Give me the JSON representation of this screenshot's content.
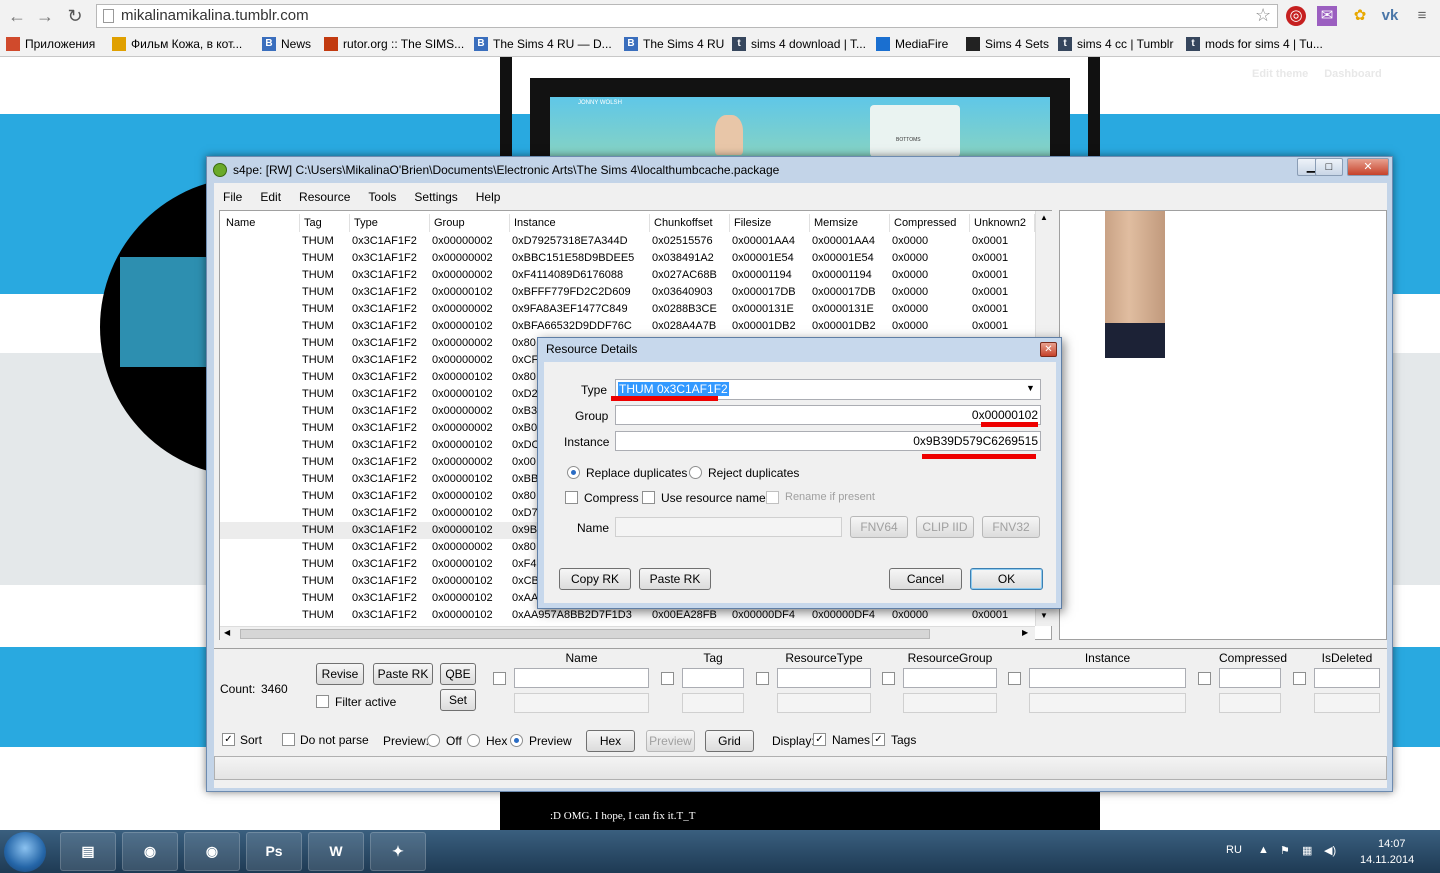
{
  "browser": {
    "url": "mikalinamikalina.tumblr.com",
    "bookmarks": [
      {
        "label": "Приложения",
        "icon": "apps-grid-icon",
        "color": "#d04a2c"
      },
      {
        "label": "Фильм Кожа, в кот...",
        "icon": "film-icon",
        "color": "#e0a000"
      },
      {
        "label": "News",
        "icon": "b-icon",
        "color": "#3a6ebd"
      },
      {
        "label": "rutor.org :: The SIMS...",
        "icon": "rutor-icon",
        "color": "#c23a10"
      },
      {
        "label": "The Sims 4 RU — D...",
        "icon": "b-icon",
        "color": "#3a6ebd"
      },
      {
        "label": "The Sims 4 RU",
        "icon": "b-icon",
        "color": "#3a6ebd"
      },
      {
        "label": "sims 4 download | T...",
        "icon": "tumblr-icon",
        "color": "#36465d"
      },
      {
        "label": "MediaFire",
        "icon": "mediafire-icon",
        "color": "#1a6fd0"
      },
      {
        "label": "Sims 4 Sets",
        "icon": "tsr-icon",
        "color": "#222"
      },
      {
        "label": "sims 4 cc | Tumblr",
        "icon": "tumblr-icon",
        "color": "#36465d"
      },
      {
        "label": "mods for sims 4 | Tu...",
        "icon": "tumblr-icon",
        "color": "#36465d"
      }
    ]
  },
  "blog": {
    "edit_theme": "Edit theme",
    "dashboard": "Dashboard",
    "caption": ":D OMG. I hope, I can fix it.T_T",
    "game_name": "JONNY WOLSH",
    "game_category": "BOTTOMS"
  },
  "s4pe": {
    "title": "s4pe: [RW] C:\\Users\\MikalinaO'Brien\\Documents\\Electronic Arts\\The Sims 4\\localthumbcache.package",
    "menu": [
      "File",
      "Edit",
      "Resource",
      "Tools",
      "Settings",
      "Help"
    ],
    "columns": [
      "Name",
      "Tag",
      "Type",
      "Group",
      "Instance",
      "Chunkoffset",
      "Filesize",
      "Memsize",
      "Compressed",
      "Unknown2"
    ],
    "rows": [
      [
        "",
        "THUM",
        "0x3C1AF1F2",
        "0x00000002",
        "0xD79257318E7A344D",
        "0x02515576",
        "0x00001AA4",
        "0x00001AA4",
        "0x0000",
        "0x0001"
      ],
      [
        "",
        "THUM",
        "0x3C1AF1F2",
        "0x00000002",
        "0xBBC151E58D9BDEE5",
        "0x038491A2",
        "0x00001E54",
        "0x00001E54",
        "0x0000",
        "0x0001"
      ],
      [
        "",
        "THUM",
        "0x3C1AF1F2",
        "0x00000002",
        "0xF4114089D6176088",
        "0x027AC68B",
        "0x00001194",
        "0x00001194",
        "0x0000",
        "0x0001"
      ],
      [
        "",
        "THUM",
        "0x3C1AF1F2",
        "0x00000102",
        "0xBFFF779FD2C2D609",
        "0x03640903",
        "0x000017DB",
        "0x000017DB",
        "0x0000",
        "0x0001"
      ],
      [
        "",
        "THUM",
        "0x3C1AF1F2",
        "0x00000002",
        "0x9FA8A3EF1477C849",
        "0x0288B3CE",
        "0x0000131E",
        "0x0000131E",
        "0x0000",
        "0x0001"
      ],
      [
        "",
        "THUM",
        "0x3C1AF1F2",
        "0x00000102",
        "0xBFA66532D9DDF76C",
        "0x028A4A7B",
        "0x00001DB2",
        "0x00001DB2",
        "0x0000",
        "0x0001"
      ],
      [
        "",
        "THUM",
        "0x3C1AF1F2",
        "0x00000002",
        "0x80",
        "",
        "",
        "",
        "",
        ""
      ],
      [
        "",
        "THUM",
        "0x3C1AF1F2",
        "0x00000002",
        "0xCF",
        "",
        "",
        "",
        "",
        ""
      ],
      [
        "",
        "THUM",
        "0x3C1AF1F2",
        "0x00000102",
        "0x80",
        "",
        "",
        "",
        "",
        ""
      ],
      [
        "",
        "THUM",
        "0x3C1AF1F2",
        "0x00000102",
        "0xD2",
        "",
        "",
        "",
        "",
        ""
      ],
      [
        "",
        "THUM",
        "0x3C1AF1F2",
        "0x00000002",
        "0xB3",
        "",
        "",
        "",
        "",
        ""
      ],
      [
        "",
        "THUM",
        "0x3C1AF1F2",
        "0x00000002",
        "0xB0",
        "",
        "",
        "",
        "",
        ""
      ],
      [
        "",
        "THUM",
        "0x3C1AF1F2",
        "0x00000102",
        "0xDC",
        "",
        "",
        "",
        "",
        ""
      ],
      [
        "",
        "THUM",
        "0x3C1AF1F2",
        "0x00000002",
        "0x00",
        "",
        "",
        "",
        "",
        ""
      ],
      [
        "",
        "THUM",
        "0x3C1AF1F2",
        "0x00000102",
        "0xBB",
        "",
        "",
        "",
        "",
        ""
      ],
      [
        "",
        "THUM",
        "0x3C1AF1F2",
        "0x00000102",
        "0x80",
        "",
        "",
        "",
        "",
        ""
      ],
      [
        "",
        "THUM",
        "0x3C1AF1F2",
        "0x00000102",
        "0xD7",
        "",
        "",
        "",
        "",
        ""
      ],
      [
        "",
        "THUM",
        "0x3C1AF1F2",
        "0x00000102",
        "0x9B",
        "",
        "",
        "",
        "",
        ""
      ],
      [
        "",
        "THUM",
        "0x3C1AF1F2",
        "0x00000002",
        "0x80",
        "",
        "",
        "",
        "",
        ""
      ],
      [
        "",
        "THUM",
        "0x3C1AF1F2",
        "0x00000102",
        "0xF4",
        "",
        "",
        "",
        "",
        ""
      ],
      [
        "",
        "THUM",
        "0x3C1AF1F2",
        "0x00000102",
        "0xCB",
        "",
        "",
        "",
        "",
        ""
      ],
      [
        "",
        "THUM",
        "0x3C1AF1F2",
        "0x00000102",
        "0xAA",
        "",
        "",
        "",
        "",
        ""
      ],
      [
        "",
        "THUM",
        "0x3C1AF1F2",
        "0x00000102",
        "0xAA957A8BB2D7F1D3",
        "0x00EA28FB",
        "0x00000DF4",
        "0x00000DF4",
        "0x0000",
        "0x0001"
      ]
    ],
    "selected_row": 17,
    "count_label": "Count:",
    "count_value": "3460",
    "revise": "Revise",
    "paste_rk": "Paste RK",
    "qbe": "QBE",
    "set": "Set",
    "filter_active": "Filter active",
    "filter_columns": [
      "Name",
      "Tag",
      "ResourceType",
      "ResourceGroup",
      "Instance",
      "Compressed",
      "IsDeleted"
    ],
    "sort": "Sort",
    "do_not_parse": "Do not parse",
    "preview_label": "Preview:",
    "preview_off": "Off",
    "preview_hex": "Hex",
    "preview_preview": "Preview",
    "btn_hex": "Hex",
    "btn_preview": "Preview",
    "btn_grid": "Grid",
    "display_label": "Display:",
    "display_names": "Names",
    "display_tags": "Tags"
  },
  "dialog": {
    "title": "Resource Details",
    "type_label": "Type",
    "type_value": "THUM 0x3C1AF1F2",
    "group_label": "Group",
    "group_value": "0x00000102",
    "instance_label": "Instance",
    "instance_value": "0x9B39D579C6269515",
    "replace_duplicates": "Replace duplicates",
    "reject_duplicates": "Reject duplicates",
    "compress": "Compress",
    "use_resource_name": "Use resource name",
    "rename_if_present": "Rename if present",
    "name_label": "Name",
    "fnv64": "FNV64",
    "clip_iid": "CLIP IID",
    "fnv32": "FNV32",
    "copy_rk": "Copy RK",
    "paste_rk": "Paste RK",
    "cancel": "Cancel",
    "ok": "OK"
  },
  "taskbar": {
    "apps": [
      {
        "name": "file-explorer-icon",
        "glyph": "▤"
      },
      {
        "name": "chrome-icon",
        "glyph": "◉"
      },
      {
        "name": "chrome-profile-icon",
        "glyph": "◉"
      },
      {
        "name": "photoshop-icon",
        "glyph": "Ps"
      },
      {
        "name": "word-icon",
        "glyph": "W"
      },
      {
        "name": "s4pe-icon",
        "glyph": "✦"
      }
    ],
    "lang": "RU",
    "time": "14:07",
    "date": "14.11.2014"
  }
}
